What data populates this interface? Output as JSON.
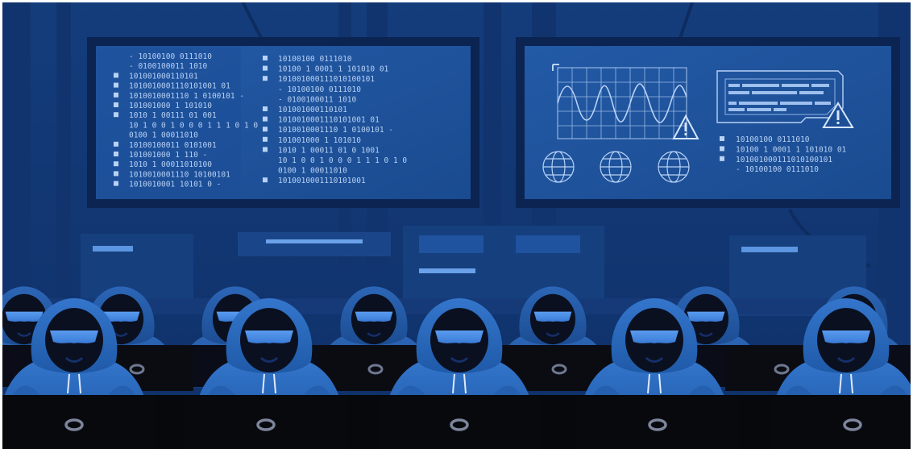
{
  "scene": {
    "colors": {
      "background": "#123772",
      "wall_dark": "#0d2a5c",
      "screen_frame": "#0b2452",
      "screen_panel": "#1c4f98",
      "text": "#b8d2f6",
      "hood": "#2e6cc0",
      "hood_front": "#2a66bb",
      "face": "#0a1020",
      "goggles": "#4c8fe6",
      "laptop": "#0a0b0f",
      "floor_strip": "#0a0f1e"
    },
    "left_monitor": {
      "left_column": [
        "- 10100100 0111010",
        "- 0100100011 1010",
        "101001000110101",
        "1010010001110101001 01",
        "1010010001110 1 0100101 -",
        "101001000 1 101010",
        "1010 1 00111 01 001",
        "10 1 0 0 1 0 0 0 1 1 1 0 1 0",
        "0100 1 00011010",
        "10100100011 0101001",
        "101001000 1 110 -",
        "1010 1 00011010100",
        "1010010001110 10100101",
        "1010010001 10101 0 -"
      ],
      "left_column_bullets": [
        false,
        false,
        true,
        true,
        true,
        true,
        true,
        false,
        false,
        true,
        true,
        true,
        true,
        true
      ],
      "right_column": [
        "10100100 0111010",
        "10100 1 0001 1 101010 01",
        "101001000111010100101",
        "- 10100100 0111010",
        "- 0100100011 1010",
        "101001000110101",
        "1010010001110101001 01",
        "1010010001110 1 0100101 -",
        "101001000 1 101010",
        "1010 1 00011 01 0 1001",
        "10 1 0 0 1 0 0 0 1 1 1 0 1 0",
        "0100 1 00011010",
        "1010010001110101001"
      ],
      "right_column_bullets": [
        true,
        true,
        true,
        false,
        false,
        true,
        true,
        true,
        true,
        true,
        false,
        false,
        true
      ]
    },
    "right_monitor": {
      "binary_lines": [
        "10100100 0111010",
        "10100 1 0001 1 101010 01",
        "101001000111010100101",
        "- 10100100 0111010"
      ],
      "binary_bullets": [
        true,
        true,
        true,
        false
      ],
      "warning_icons": [
        "warning-icon",
        "warning-icon"
      ],
      "globe_icons": [
        "globe-icon",
        "globe-icon",
        "globe-icon"
      ],
      "waveform": "sine-wave-graph"
    },
    "figures": {
      "back_row_count": 7,
      "front_row_count": 5,
      "icon": "hooded-hacker-icon"
    }
  }
}
